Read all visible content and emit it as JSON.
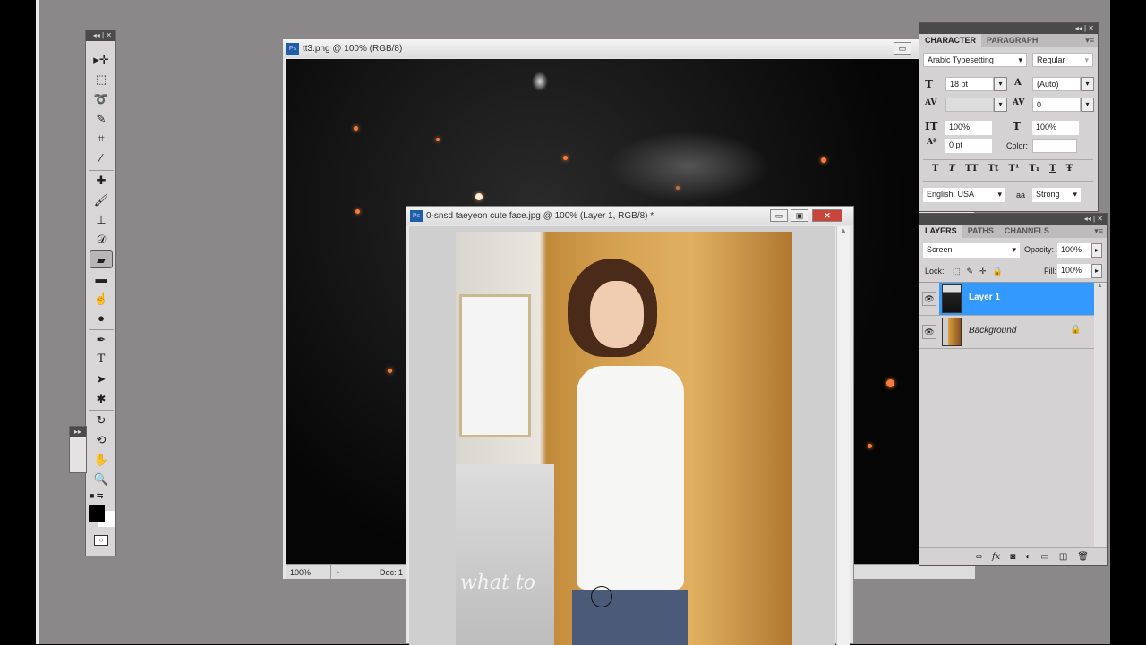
{
  "toolbox": {
    "tools": [
      "move-tool",
      "marquee-tool",
      "lasso-tool",
      "quick-selection-tool",
      "crop-tool",
      "eyedropper-tool",
      "healing-brush-tool",
      "brush-tool",
      "clone-stamp-tool",
      "history-brush-tool",
      "eraser-tool",
      "gradient-tool",
      "blur-tool",
      "dodge-tool",
      "pen-tool",
      "type-tool",
      "path-selection-tool",
      "custom-shape-tool",
      "3d-rotate-tool",
      "3d-orbit-tool",
      "hand-tool",
      "zoom-tool"
    ],
    "selected": "eraser-tool",
    "type_label": "T",
    "foreground": "#000000",
    "background": "#ffffff"
  },
  "doc1": {
    "title": "tt3.png @ 100% (RGB/8)",
    "zoom": "100%",
    "doc_label": "Doc: 1"
  },
  "doc2": {
    "title": "0-snsd taeyeon cute face.jpg @ 100% (Layer 1, RGB/8) *",
    "overlay_text": "what to"
  },
  "character": {
    "tabs": [
      "CHARACTER",
      "PARAGRAPH"
    ],
    "font_family": "Arabic Typesetting",
    "font_style": "Regular",
    "font_size": "18 pt",
    "leading": "(Auto)",
    "kerning": "",
    "tracking": "0",
    "vertical_scale": "100%",
    "horizontal_scale": "100%",
    "baseline_shift": "0 pt",
    "color_label": "Color:",
    "language": "English: USA",
    "antialias_icon": "aa",
    "antialias": "Strong",
    "style_buttons": [
      "T",
      "T",
      "TT",
      "Tt",
      "T¹",
      "T₁",
      "T",
      "Ŧ"
    ]
  },
  "layers": {
    "tabs": [
      "LAYERS",
      "PATHS",
      "CHANNELS"
    ],
    "blend_mode": "Screen",
    "opacity_label": "Opacity:",
    "opacity": "100%",
    "lock_label": "Lock:",
    "fill_label": "Fill:",
    "fill": "100%",
    "items": [
      {
        "name": "Layer 1",
        "selected": true
      },
      {
        "name": "Background",
        "locked": true
      }
    ],
    "accent": "#3399ff"
  }
}
